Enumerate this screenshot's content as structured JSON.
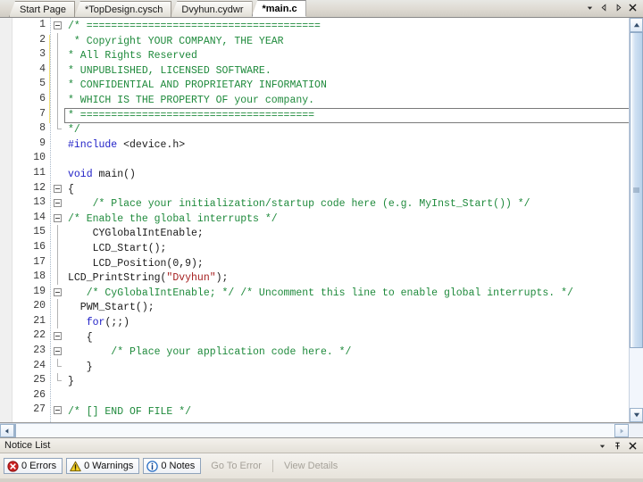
{
  "window": {
    "tabs": [
      {
        "label": "Start Page",
        "active": false,
        "modified": false
      },
      {
        "label": "*TopDesign.cysch",
        "active": false,
        "modified": true
      },
      {
        "label": "Dvyhun.cydwr",
        "active": false,
        "modified": false
      },
      {
        "label": "*main.c",
        "active": true,
        "modified": true
      }
    ],
    "tab_controls": [
      {
        "name": "tab-list-dropdown",
        "glyph": "▼"
      },
      {
        "name": "tab-scroll-left",
        "glyph": "◁"
      },
      {
        "name": "tab-scroll-right",
        "glyph": "▷"
      },
      {
        "name": "tab-close",
        "glyph": "✕"
      }
    ]
  },
  "editor": {
    "current_line": 7,
    "modified_lines": [
      2,
      3,
      4,
      5,
      6,
      7
    ],
    "lines": [
      {
        "n": 1,
        "fold": "start",
        "tokens": [
          {
            "t": "/* ======================================",
            "c": "cmt"
          }
        ],
        "indent": 0
      },
      {
        "n": 2,
        "fold": "bar",
        "tokens": [
          {
            "t": " * Copyright YOUR COMPANY, THE YEAR",
            "c": "cmt"
          }
        ],
        "indent": 1
      },
      {
        "n": 3,
        "fold": "bar",
        "tokens": [
          {
            "t": "* All Rights Reserved",
            "c": "cmt"
          }
        ],
        "indent": 1
      },
      {
        "n": 4,
        "fold": "bar",
        "tokens": [
          {
            "t": "* UNPUBLISHED, LICENSED SOFTWARE.",
            "c": "cmt"
          }
        ],
        "indent": 1
      },
      {
        "n": 5,
        "fold": "bar",
        "tokens": [
          {
            "t": "* CONFIDENTIAL AND PROPRIETARY INFORMATION",
            "c": "cmt"
          }
        ],
        "indent": 1
      },
      {
        "n": 6,
        "fold": "bar",
        "tokens": [
          {
            "t": "* WHICH IS THE PROPERTY OF your company.",
            "c": "cmt"
          }
        ],
        "indent": 1
      },
      {
        "n": 7,
        "fold": "bar",
        "tokens": [
          {
            "t": "* ======================================",
            "c": "cmt"
          }
        ],
        "indent": 1
      },
      {
        "n": 8,
        "fold": "end",
        "tokens": [
          {
            "t": "*/",
            "c": "cmt"
          }
        ],
        "indent": 0
      },
      {
        "n": 9,
        "fold": "none",
        "tokens": [
          {
            "t": "#include",
            "c": "kw"
          },
          {
            "t": " <device.h>",
            "c": "pln"
          }
        ],
        "indent": 0
      },
      {
        "n": 10,
        "fold": "none",
        "tokens": [],
        "indent": 0
      },
      {
        "n": 11,
        "fold": "none",
        "tokens": [
          {
            "t": "void",
            "c": "kw"
          },
          {
            "t": " main()",
            "c": "pln"
          }
        ],
        "indent": 0
      },
      {
        "n": 12,
        "fold": "start",
        "tokens": [
          {
            "t": "{",
            "c": "pln"
          }
        ],
        "indent": 0
      },
      {
        "n": 13,
        "fold": "start",
        "tokens": [
          {
            "t": "    /* Place your initialization/startup code here (e.g. MyInst_Start()) */",
            "c": "cmt"
          }
        ],
        "indent": 0
      },
      {
        "n": 14,
        "fold": "start",
        "tokens": [
          {
            "t": "/* Enable the global interrupts */",
            "c": "cmt"
          }
        ],
        "indent": -1
      },
      {
        "n": 15,
        "fold": "line",
        "tokens": [
          {
            "t": "    CYGlobalIntEnable;",
            "c": "pln"
          }
        ],
        "indent": 0
      },
      {
        "n": 16,
        "fold": "line",
        "tokens": [
          {
            "t": "    LCD_Start();",
            "c": "pln"
          }
        ],
        "indent": 0
      },
      {
        "n": 17,
        "fold": "line",
        "tokens": [
          {
            "t": "    LCD_Position(0,9);",
            "c": "pln"
          }
        ],
        "indent": 0
      },
      {
        "n": 18,
        "fold": "line",
        "tokens": [
          {
            "t": "LCD_PrintString(",
            "c": "pln"
          },
          {
            "t": "\"Dvyhun\"",
            "c": "str"
          },
          {
            "t": ");",
            "c": "pln"
          }
        ],
        "indent": -1
      },
      {
        "n": 19,
        "fold": "start",
        "tokens": [
          {
            "t": "   /* CyGlobalIntEnable; */ /* Uncomment this line to enable global interrupts. */",
            "c": "cmt"
          }
        ],
        "indent": 0
      },
      {
        "n": 20,
        "fold": "line",
        "tokens": [
          {
            "t": "  PWM_Start();",
            "c": "pln"
          }
        ],
        "indent": 0
      },
      {
        "n": 21,
        "fold": "line",
        "tokens": [
          {
            "t": "   ",
            "c": "pln"
          },
          {
            "t": "for",
            "c": "kw"
          },
          {
            "t": "(;;)",
            "c": "pln"
          }
        ],
        "indent": 0
      },
      {
        "n": 22,
        "fold": "start",
        "tokens": [
          {
            "t": "   {",
            "c": "pln"
          }
        ],
        "indent": 0
      },
      {
        "n": 23,
        "fold": "start",
        "tokens": [
          {
            "t": "       /* Place your application code here. */",
            "c": "cmt"
          }
        ],
        "indent": 0
      },
      {
        "n": 24,
        "fold": "end",
        "tokens": [
          {
            "t": "   }",
            "c": "pln"
          }
        ],
        "indent": 0
      },
      {
        "n": 25,
        "fold": "end",
        "tokens": [
          {
            "t": "}",
            "c": "pln"
          }
        ],
        "indent": 0
      },
      {
        "n": 26,
        "fold": "none",
        "tokens": [],
        "indent": 0
      },
      {
        "n": 27,
        "fold": "start",
        "tokens": [
          {
            "t": "/* [] END OF FILE */",
            "c": "cmt"
          }
        ],
        "indent": 0
      }
    ]
  },
  "notice_list": {
    "title": "Notice List",
    "title_controls": [
      {
        "name": "notice-dropdown",
        "glyph": "▼"
      },
      {
        "name": "notice-pin",
        "glyph": "pin"
      },
      {
        "name": "notice-close",
        "glyph": "✕"
      }
    ],
    "buttons": [
      {
        "name": "errors-filter-button",
        "label": "0 Errors",
        "icon": "error-icon",
        "enabled": true
      },
      {
        "name": "warnings-filter-button",
        "label": "0 Warnings",
        "icon": "warning-icon",
        "enabled": true
      },
      {
        "name": "notes-filter-button",
        "label": "0 Notes",
        "icon": "info-icon",
        "enabled": true
      }
    ],
    "actions": [
      {
        "name": "go-to-error-button",
        "label": "Go To Error",
        "enabled": false
      },
      {
        "name": "view-details-button",
        "label": "View Details",
        "enabled": false
      }
    ]
  },
  "colors": {
    "comment": "#1f8a3c",
    "keyword": "#2121c7",
    "string": "#a52020",
    "plain": "#1a1a1a",
    "change_bar": "#f2df7c",
    "error": "#cc2222",
    "warning": "#e8c000",
    "info": "#2a6fc4"
  }
}
